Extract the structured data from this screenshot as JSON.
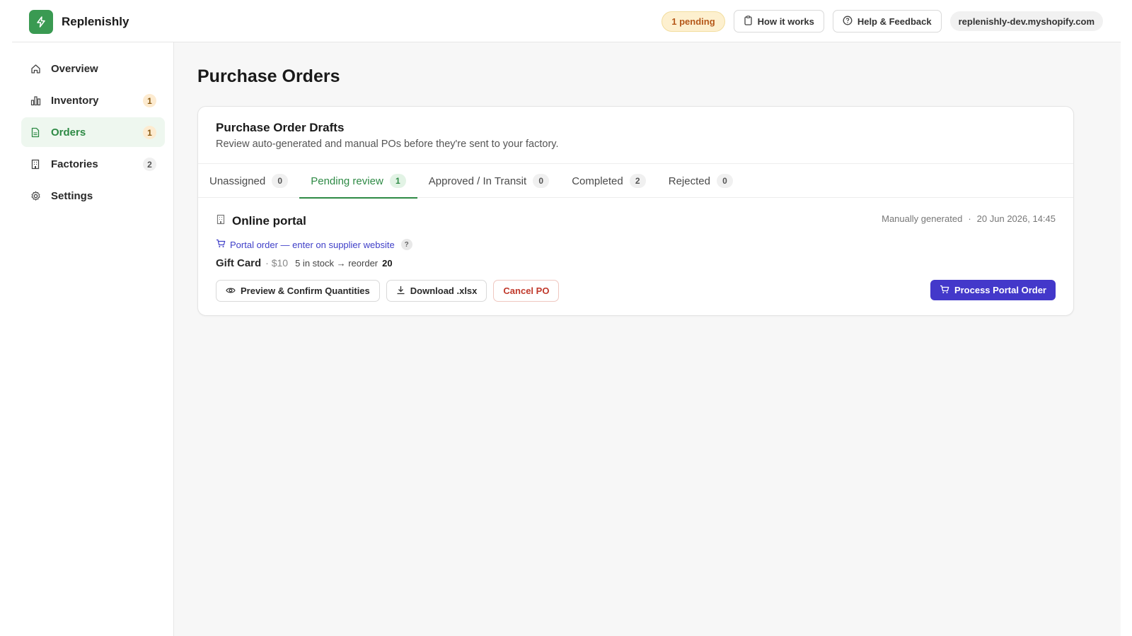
{
  "app": {
    "name": "Replenishly",
    "brand_color": "#3a9a52",
    "icon": "bolt-icon"
  },
  "topbar": {
    "pending_label": "1 pending",
    "how_it_works_label": "How it works",
    "help_label": "Help & Feedback",
    "store_domain": "replenishly-dev.myshopify.com"
  },
  "sidebar": {
    "items": [
      {
        "label": "Overview",
        "icon": "home-icon",
        "badge": "",
        "active": false
      },
      {
        "label": "Inventory",
        "icon": "bar-chart-icon",
        "badge": "1",
        "active": false
      },
      {
        "label": "Orders",
        "icon": "document-icon",
        "badge": "1",
        "active": true
      },
      {
        "label": "Factories",
        "icon": "building-icon",
        "badge": "2",
        "active": false
      },
      {
        "label": "Settings",
        "icon": "gear-icon",
        "badge": "",
        "active": false
      }
    ]
  },
  "page": {
    "title": "Purchase Orders"
  },
  "drafts_card": {
    "title": "Purchase Order Drafts",
    "subtitle": "Review auto-generated and manual POs before they're sent to your factory.",
    "tabs": [
      {
        "label": "Unassigned",
        "count": "0",
        "active": false
      },
      {
        "label": "Pending review",
        "count": "1",
        "active": true
      },
      {
        "label": "Approved / In Transit",
        "count": "0",
        "active": false
      },
      {
        "label": "Completed",
        "count": "2",
        "active": false
      },
      {
        "label": "Rejected",
        "count": "0",
        "active": false
      }
    ]
  },
  "order": {
    "factory_name": "Online portal",
    "generated": "Manually generated",
    "separator": "·",
    "timestamp": "20 Jun 2026, 14:45",
    "portal_note": "Portal order — enter on supplier website",
    "help_glyph": "?",
    "item_name": "Gift Card",
    "item_price": "· $10",
    "stock_text": "5 in stock → reorder",
    "reorder_qty": "20",
    "buttons": {
      "preview": "Preview & Confirm Quantities",
      "download": "Download .xlsx",
      "cancel": "Cancel PO",
      "process": "Process Portal Order"
    }
  },
  "colors": {
    "accent_green": "#2e8a45",
    "primary_indigo": "#4338ca",
    "danger": "#c0392b",
    "pending_bg": "#fdf0cf"
  }
}
